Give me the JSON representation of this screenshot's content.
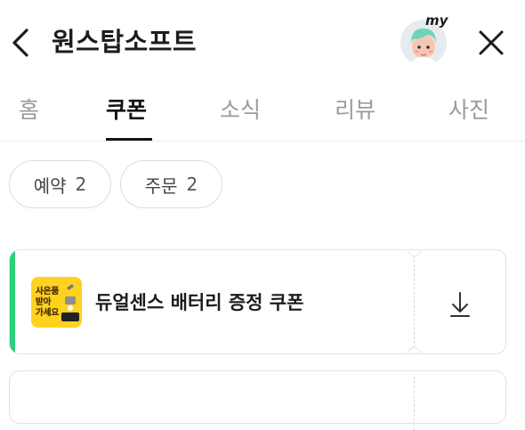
{
  "header": {
    "title": "원스탑소프트",
    "avatar_badge": "my",
    "icons": {
      "back": "chevron-left-icon",
      "close": "close-icon"
    }
  },
  "tabs": [
    {
      "label": "홈",
      "active": false
    },
    {
      "label": "쿠폰",
      "active": true
    },
    {
      "label": "소식",
      "active": false
    },
    {
      "label": "리뷰",
      "active": false
    },
    {
      "label": "사진",
      "active": false
    }
  ],
  "filters": [
    {
      "label": "예약",
      "count": "2"
    },
    {
      "label": "주문",
      "count": "2"
    }
  ],
  "coupons": [
    {
      "title": "듀얼센스 배터리 증정 쿠폰",
      "thumb_text": [
        "사은품",
        "받아",
        "가세요"
      ],
      "accent_color": "#2bd17b",
      "action_icon": "download-icon"
    }
  ],
  "colors": {
    "accent": "#2bd17b",
    "thumb_bg": "#ffd21f",
    "active_tab": "#141414",
    "inactive_tab": "#9b9b9b"
  }
}
